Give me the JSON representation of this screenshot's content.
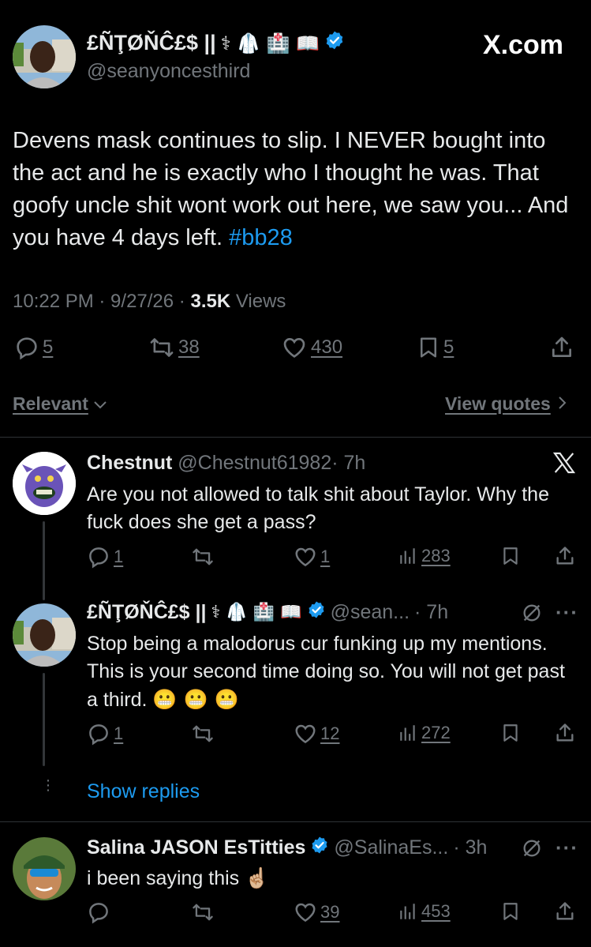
{
  "main_tweet": {
    "display_name": "£ÑŢØŇĈ£$ ||",
    "name_emojis": "⚕ 🥼 🏥 📖",
    "handle": "@seanyoncesthird",
    "brand": "X.com",
    "text": "Devens mask continues to slip. I NEVER bought into the act and he is exactly who I thought he was. That goofy uncle shit wont work out here, we saw you... And you have 4 days left.",
    "hashtag": "#bb28",
    "time": "10:22 PM · 9/27/26 ·",
    "views_count": "3.5K",
    "views_label": "Views",
    "replies": "5",
    "reposts": "38",
    "likes": "430",
    "bookmarks": "5"
  },
  "sort": {
    "relevant": "Relevant",
    "view_quotes": "View quotes"
  },
  "replies": [
    {
      "name": "Chestnut",
      "handle": "@Chestnut61982",
      "time": "· 7h",
      "text": "Are you not allowed to talk shit about Taylor. Why the fuck does she get a pass?",
      "replies": "1",
      "reposts": "",
      "likes": "1",
      "views": "283"
    },
    {
      "name": "£ÑŢØŇĈ£$ ||",
      "handle": "@sean...",
      "time": "· 7h",
      "text": "Stop being a malodorus cur funking up my mentions. This is your second time doing so. You will not get past a third.",
      "emojis": "😬 😬 😬",
      "replies": "1",
      "reposts": "",
      "likes": "12",
      "views": "272"
    },
    {
      "name": "Salina JASON EsTitties",
      "handle": "@SalinaEs...",
      "time": "· 3h",
      "text": "i been saying this",
      "emojis": "☝🏼",
      "replies": "",
      "reposts": "",
      "likes": "39",
      "views": "453"
    }
  ],
  "show_replies": "Show replies",
  "colors": {
    "background": "#000000",
    "text": "#e7e9ea",
    "secondary": "#71767b",
    "accent": "#1d9bf0"
  }
}
